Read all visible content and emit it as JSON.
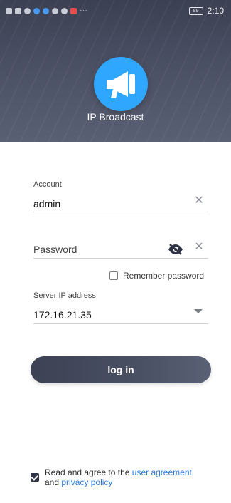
{
  "status_bar": {
    "time": "2:10",
    "battery": "89"
  },
  "app": {
    "title": "IP Broadcast"
  },
  "form": {
    "account": {
      "label": "Account",
      "value": "admin"
    },
    "password": {
      "placeholder": "Password"
    },
    "remember_password": {
      "label": "Remember password",
      "checked": false
    },
    "server_ip": {
      "label": "Server IP address",
      "value": "172.16.21.35"
    },
    "login_button": "log in"
  },
  "agreement": {
    "prefix": "Read and agree to the",
    "user_agreement": "user agreement",
    "and": "and",
    "privacy_policy": "privacy policy",
    "checked": true
  },
  "colors": {
    "header_bg": "#4a5063",
    "accent": "#2fa7ff",
    "link": "#2a7de1",
    "button_bg": "#4a5064"
  },
  "icons": {
    "logo": "megaphone-icon",
    "clear": "clear-x-icon",
    "password_visibility": "eye-slash-icon",
    "dropdown": "triangle-down-icon"
  }
}
